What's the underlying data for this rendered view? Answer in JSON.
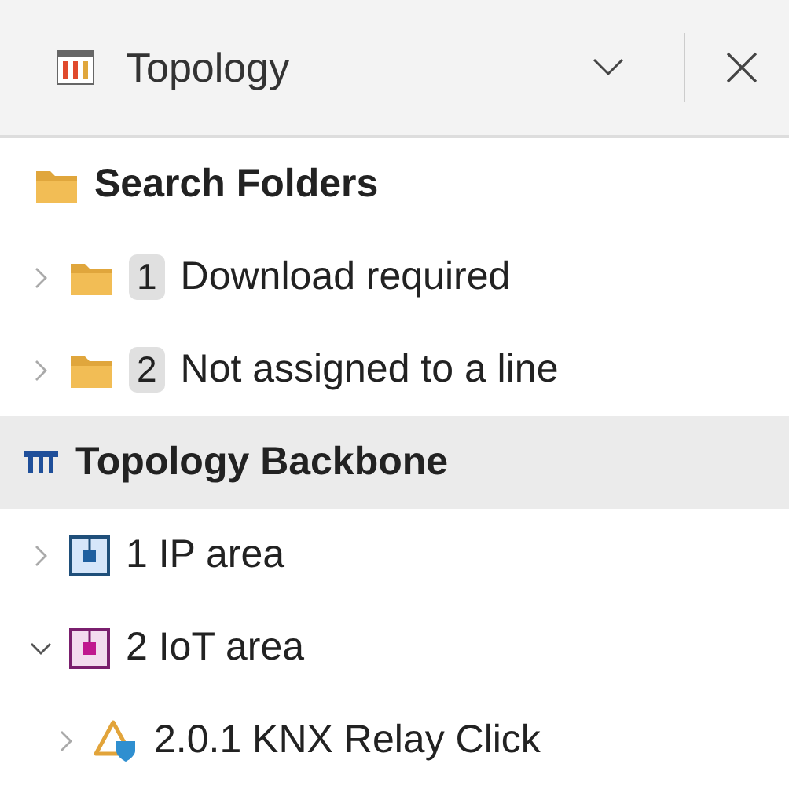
{
  "panel": {
    "title": "Topology"
  },
  "search_folders": {
    "label": "Search Folders",
    "items": [
      {
        "number": "1",
        "label": "Download required",
        "expanded": false,
        "selected": false
      },
      {
        "number": "2",
        "label": "Not assigned to a line",
        "expanded": false,
        "selected": false
      }
    ]
  },
  "backbone": {
    "label": "Topology Backbone",
    "selected": true,
    "children": [
      {
        "kind": "ip-area",
        "label": "1 IP area",
        "expanded": false,
        "selected": false
      },
      {
        "kind": "iot-area",
        "label": "2 IoT area",
        "expanded": true,
        "selected": false,
        "children": [
          {
            "kind": "device",
            "label": "2.0.1 KNX Relay Click",
            "expanded": false,
            "selected": false
          }
        ]
      }
    ]
  }
}
